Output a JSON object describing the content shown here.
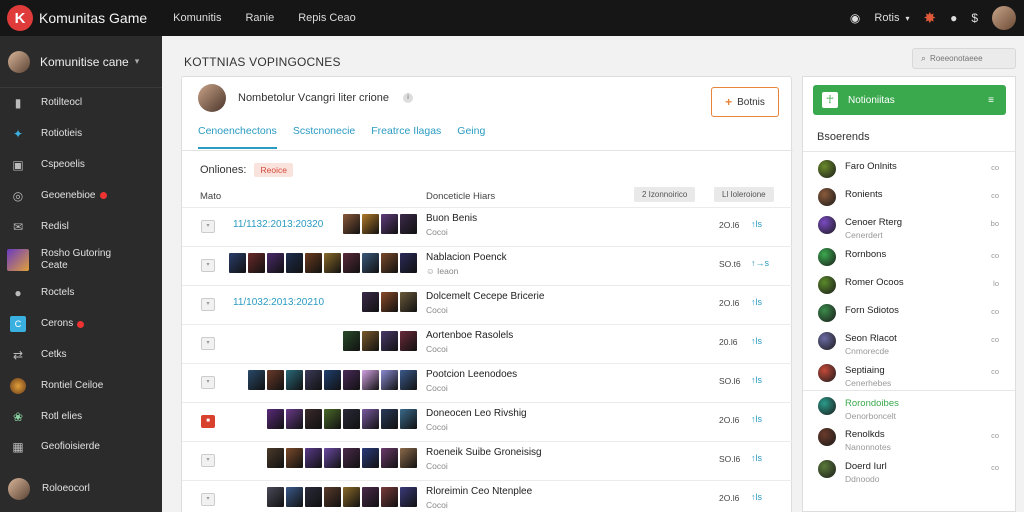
{
  "app": {
    "brand": "Komunitas Game",
    "logo_glyph": "K",
    "accent": "#e03b3b",
    "link_color": "#2a9bc1",
    "green": "#3aa94e"
  },
  "topbar": {
    "nav": [
      "Komunitis",
      "Ranie",
      "Repis Ceao"
    ],
    "right_label": "Rotis",
    "icons": [
      "globe-icon",
      "puzzle-icon",
      "location-pin-icon",
      "dollar-icon",
      "user-avatar"
    ]
  },
  "sidebar": {
    "title": "Komunitise cane",
    "items": [
      {
        "label": "Rotilteocl",
        "icon": "bar-chart-icon"
      },
      {
        "label": "Rotiotieis",
        "icon": "game-icon"
      },
      {
        "label": "Cspeoelis",
        "icon": "monitor-icon"
      },
      {
        "label": "Geoenebioe",
        "icon": "circle-icon",
        "dot": true
      },
      {
        "label": "Redisl",
        "icon": "mail-icon"
      },
      {
        "label": "Rosho Gutoring Ceate",
        "icon": "avatar-icon"
      },
      {
        "label": "Roctels",
        "icon": "headset-icon"
      },
      {
        "label": "Cerons",
        "icon": "c-icon",
        "dot": true
      },
      {
        "label": "Cetks",
        "icon": "shuffle-icon"
      },
      {
        "label": "Rontiel Ceiloe",
        "icon": "hero-icon"
      },
      {
        "label": "Rotl elies",
        "icon": "globe-icon"
      },
      {
        "label": "Geofioisierde",
        "icon": "grid-icon"
      }
    ],
    "footer_label": "Roloeocorl"
  },
  "main": {
    "page_title": "KOTTNIAS VOPINGOCNES",
    "card": {
      "user_name": "Nombetolur Vcangri liter crione",
      "follow_label": "Botnis",
      "tabs": [
        "Cenoenchectons",
        "Scstcnonecie",
        "Freatrce Ilagas",
        "Geing"
      ],
      "filter_label": "Onliones:",
      "filter_badge": "Reoice",
      "col_left": "Mato",
      "col_mid": "Donceticle Hiars",
      "chip1": "2 Izonnoirico",
      "chip2": "Ll Ioleroione"
    },
    "rows": [
      {
        "date": "11/1132:2013:20320",
        "name": "Buon Benis",
        "sub": "Cocoi",
        "num": "2O.l6",
        "icon": "↑ls",
        "checkbox": "plain",
        "thumbs": [
          "#8a5a3a",
          "#b07a2a",
          "#5e3b7a",
          "#3b2a4a"
        ]
      },
      {
        "date": "",
        "name": "Nablacion Poenck",
        "sub": "☺ Ieaon",
        "num": "SO.t6",
        "icon": "↑→s",
        "checkbox": "plain",
        "thumbs": [
          "#2a3d6b",
          "#6b2a2a",
          "#4a2a6b",
          "#1f2f4f",
          "#6b3b1f",
          "#8a6a2a",
          "#5a2a3a",
          "#3a5a7a",
          "#7a4a2a",
          "#2a2a5a"
        ]
      },
      {
        "date": "11/1032:2013:20210",
        "name": "Dolcemelt Cecepe Bricerie",
        "sub": "Cocoi",
        "num": "2O.l6",
        "icon": "↑ls",
        "checkbox": "plain",
        "thumbs": [
          "#3a2a4a",
          "#8a4a2a",
          "#6a5a3a"
        ]
      },
      {
        "date": "",
        "name": "Aortenboe Rasolels",
        "sub": "Cocoi",
        "num": "20.l6",
        "icon": "↑ls",
        "checkbox": "plain",
        "thumbs": [
          "#2a4a2a",
          "#7a5a2a",
          "#4a3a6a",
          "#6a2a3a"
        ]
      },
      {
        "date": "",
        "name": "Pootcion Leenodoes",
        "sub": "Cocoi",
        "num": "SO.l6",
        "icon": "↑ls",
        "checkbox": "plain",
        "thumbs": [
          "#2a4a6a",
          "#6a3a2a",
          "#2a6a7a",
          "#3a3a5a",
          "#1f3f6f",
          "#4a2a5a",
          "#d2a2e2",
          "#8a8ad2",
          "#3a5a8a"
        ]
      },
      {
        "date": "",
        "name": "Doneocen Leo Rivshig",
        "sub": "Cocoi",
        "num": "2O.l6",
        "icon": "↑ls",
        "checkbox": "red",
        "thumbs": [
          "#5a2a7a",
          "#6a3a8a",
          "#3a2a2a",
          "#4a6a2a",
          "#2a2a3a",
          "#7a5aa2",
          "#2a3a5a",
          "#3a6a8a"
        ]
      },
      {
        "date": "",
        "name": "Roeneik Suibe Groneisisg",
        "sub": "Cocoi",
        "num": "SO.l6",
        "icon": "↑ls",
        "checkbox": "plain",
        "thumbs": [
          "#4a3a2a",
          "#7a4a2a",
          "#5a3a8a",
          "#6a4aa2",
          "#4a2a4a",
          "#2a3a7a",
          "#6a3a6a",
          "#8a6a4a"
        ]
      },
      {
        "date": "",
        "name": "Rloreimin Ceo Ntenplee",
        "sub": "Cocoi",
        "num": "2O.l6",
        "icon": "↑ls",
        "checkbox": "plain",
        "thumbs": [
          "#4a4a5a",
          "#3a5a8a",
          "#2a2a3a",
          "#5a3a2a",
          "#8a6a2a",
          "#4a2a4a",
          "#7a3a3a",
          "#3a3a7a"
        ]
      }
    ]
  },
  "right": {
    "search_placeholder": "Roeeonotaeee",
    "green_button": "Notioniitas",
    "green_menu": "≡",
    "section_title": "Bsoerends",
    "items": [
      {
        "name": "Faro Onlnits",
        "sub": "",
        "tag": "co",
        "color": "#6a8a2a",
        "green": false
      },
      {
        "name": "Ronients",
        "sub": "",
        "tag": "co",
        "color": "#8a5a3a",
        "green": false
      },
      {
        "name": "Cenoer Rterg",
        "sub": "Cenerdert",
        "tag": "bo",
        "color": "#7a4ac2",
        "green": false
      },
      {
        "name": "Rornbons",
        "sub": "",
        "tag": "co",
        "color": "#3aa94e",
        "green": false
      },
      {
        "name": "Romer Ocoos",
        "sub": "",
        "tag": "lo",
        "color": "#5a8a2a",
        "green": false
      },
      {
        "name": "Forn Sdiotos",
        "sub": "",
        "tag": "co",
        "color": "#3a8a4a",
        "green": false
      },
      {
        "name": "Seon Rlacot",
        "sub": "Cnmorecde",
        "tag": "co",
        "color": "#6a6aa2",
        "green": false
      },
      {
        "name": "Septiaing",
        "sub": "Cenerhebes",
        "tag": "co",
        "color": "#c24a3a",
        "green": false
      },
      {
        "name": "Rorondoibes",
        "sub": "Oenorboncelt",
        "tag": "",
        "color": "#2a9b8a",
        "green": true
      },
      {
        "name": "Renolkds",
        "sub": "Nanonnotes",
        "tag": "co",
        "color": "#6a3a2a",
        "green": false
      },
      {
        "name": "Doerd Iurl",
        "sub": "Ddnoodo",
        "tag": "co",
        "color": "#5a7a3a",
        "green": false
      }
    ]
  }
}
